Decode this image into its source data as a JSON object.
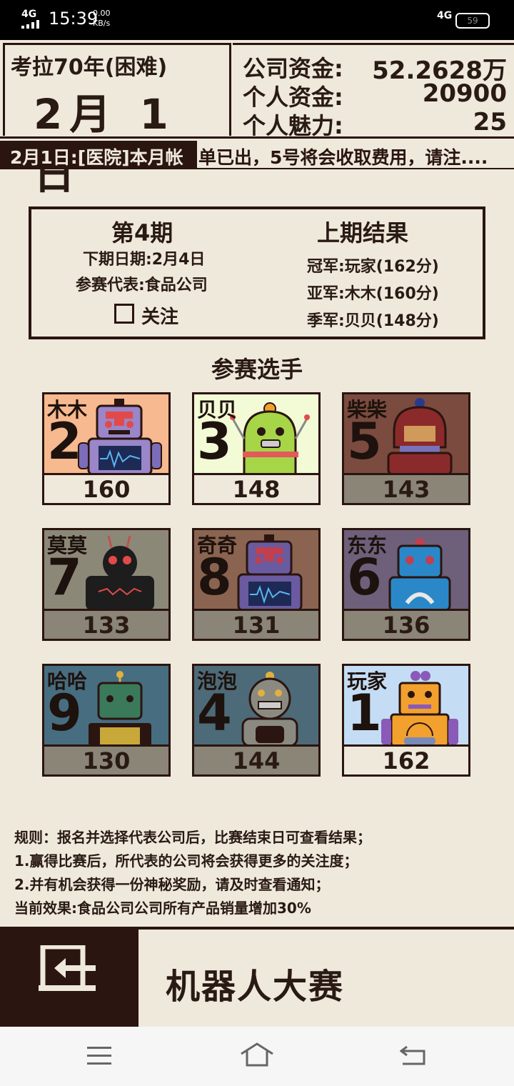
{
  "status_bar": {
    "network": "4G",
    "time": "15:39",
    "speed_value": "0.00",
    "speed_unit": "KB/s",
    "network_right": "4G",
    "battery": "59"
  },
  "header": {
    "year_label": "考拉70年(困难)",
    "date": "2月 1 日",
    "company_funds_label": "公司资金:",
    "company_funds": "52.2628万",
    "personal_funds_label": "个人资金:",
    "personal_funds": "20900",
    "charm_label": "个人魅力:",
    "charm": "25"
  },
  "ticker": {
    "text_dark": "2月1日:[医院]本月帐",
    "text_light": "单已出，5号将会收取费用，请注...."
  },
  "info": {
    "period": "第4期",
    "next_date": "下期日期:2月4日",
    "representative": "参赛代表:食品公司",
    "follow_label": "关注",
    "last_result_title": "上期结果",
    "champion": "冠军:玩家(162分)",
    "runner_up": "亚军:木木(160分)",
    "third": "季军:贝贝(148分)"
  },
  "players_title": "参赛选手",
  "players": [
    {
      "name": "木木",
      "number": "2",
      "score": "160",
      "bg": "#f7b98f",
      "score_bg": "#efe9dc",
      "robot": "purple-monitor-robot-icon"
    },
    {
      "name": "贝贝",
      "number": "3",
      "score": "148",
      "bg": "#f2fad6",
      "score_bg": "#efe9dc",
      "robot": "green-egg-robot-icon"
    },
    {
      "name": "柴柴",
      "number": "5",
      "score": "143",
      "bg": "#7b4b3f",
      "score_bg": "#8a8576",
      "robot": "red-dome-robot-icon"
    },
    {
      "name": "莫莫",
      "number": "7",
      "score": "133",
      "bg": "#8c8877",
      "score_bg": "#8a8576",
      "robot": "black-spider-robot-icon"
    },
    {
      "name": "奇奇",
      "number": "8",
      "score": "131",
      "bg": "#8a6450",
      "score_bg": "#8a8576",
      "robot": "purple-monitor-robot-icon"
    },
    {
      "name": "东东",
      "number": "6",
      "score": "136",
      "bg": "#6e5f7a",
      "score_bg": "#8a8576",
      "robot": "blue-smile-robot-icon"
    },
    {
      "name": "哈哈",
      "number": "9",
      "score": "130",
      "bg": "#476d80",
      "score_bg": "#8a8576",
      "robot": "green-box-robot-icon"
    },
    {
      "name": "泡泡",
      "number": "4",
      "score": "144",
      "bg": "#4d6a78",
      "score_bg": "#8a8576",
      "robot": "gray-grill-robot-icon"
    },
    {
      "name": "玩家",
      "number": "1",
      "score": "162",
      "bg": "#c4ddf5",
      "score_bg": "#efe9dc",
      "robot": "orange-speedometer-robot-icon"
    }
  ],
  "rules": [
    "规则：报名并选择代表公司后，比赛结束日可查看结果；",
    "1.赢得比赛后，所代表的公司将会获得更多的关注度；",
    "2.并有机会获得一份神秘奖励，请及时查看通知；",
    "当前效果:食品公司公司所有产品销量增加30%"
  ],
  "bottom": {
    "title": "机器人大赛",
    "exit_icon": "exit-door-icon"
  },
  "nav": {
    "menu_icon": "menu-icon",
    "home_icon": "home-icon",
    "back_icon": "back-icon"
  }
}
